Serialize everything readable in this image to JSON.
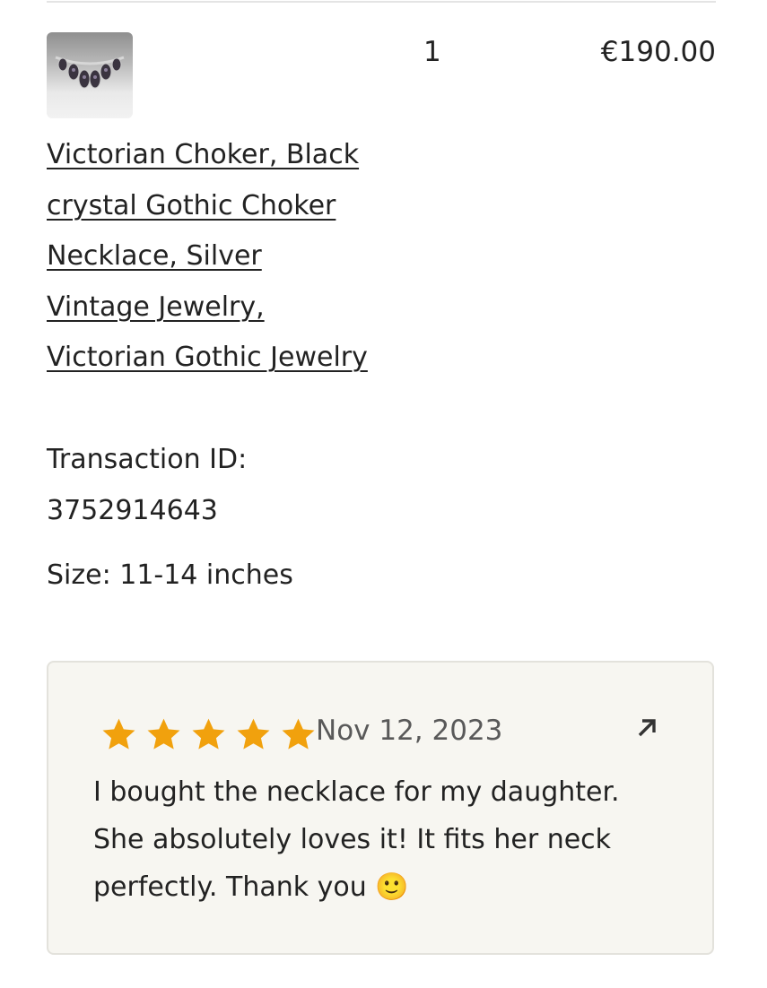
{
  "order_item": {
    "thumbnail_icon": "choker-necklace-photo",
    "quantity": "1",
    "price": "€190.00",
    "title": "Victorian Choker, Black crystal Gothic Choker Necklace, Silver Vintage Jewelry, Victorian Gothic Jewelry",
    "transaction_label": "Transaction ID:",
    "transaction_id": "3752914643",
    "size": "Size: 11-14 inches"
  },
  "review": {
    "rating": 5,
    "max_rating": 5,
    "date": "Nov 12, 2023",
    "text": "I bought the necklace for my daughter. She absolutely loves it! It fits her neck perfectly. Thank you 🙂",
    "star_color": "#f1a10d",
    "open_icon": "arrow-up-right-icon"
  }
}
